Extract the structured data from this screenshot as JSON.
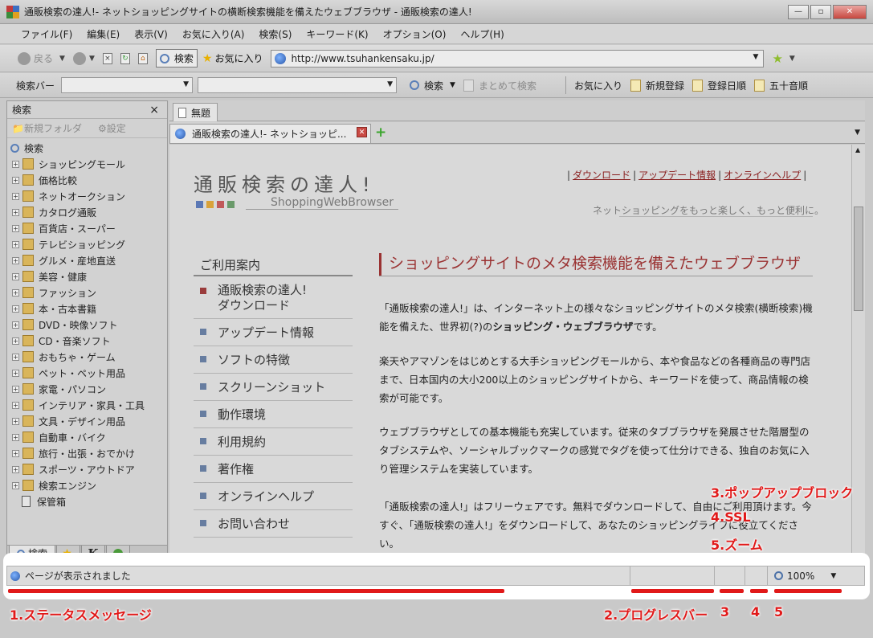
{
  "window": {
    "title": "通販検索の達人!- ネットショッピングサイトの横断検索機能を備えたウェブブラウザ - 通販検索の達人!",
    "icon_colors": [
      "#c23b3b",
      "#3b6fc2",
      "#3b8c3b",
      "#e0a020"
    ]
  },
  "menu": [
    "ファイル(F)",
    "編集(E)",
    "表示(V)",
    "お気に入り(A)",
    "検索(S)",
    "キーワード(K)",
    "オプション(O)",
    "ヘルプ(H)"
  ],
  "toolbar": {
    "back": "戻る",
    "search": "検索",
    "favorites": "お気に入り",
    "url": "http://www.tsuhankensaku.jp/"
  },
  "searchbar": {
    "label": "検索バー",
    "search_button": "検索",
    "batch_search": "まとめて検索",
    "favorites": "お気に入り",
    "new_register": "新規登録",
    "by_date": "登録日順",
    "by_kana": "五十音順"
  },
  "left_panel": {
    "title": "検索",
    "close": "×",
    "new_folder": "新規フォルダ",
    "settings": "設定",
    "root": "検索",
    "items": [
      "ショッピングモール",
      "価格比較",
      "ネットオークション",
      "カタログ通販",
      "百貨店・スーパー",
      "テレビショッピング",
      "グルメ・産地直送",
      "美容・健康",
      "ファッション",
      "本・古本書籍",
      "DVD・映像ソフト",
      "CD・音楽ソフト",
      "おもちゃ・ゲーム",
      "ペット・ペット用品",
      "家電・パソコン",
      "インテリア・家具・工具",
      "文具・デザイン用品",
      "自動車・バイク",
      "旅行・出張・おでかけ",
      "スポーツ・アウトドア",
      "検索エンジン"
    ],
    "storage": "保管箱",
    "tabs": {
      "search": "検索",
      "k": "K"
    }
  },
  "tabs": {
    "group": "無題",
    "page": "通販検索の達人!- ネットショッピ..."
  },
  "page": {
    "logo": "通販検索の達人!",
    "logo_sub": "ShoppingWebBrowser",
    "logo_colors": [
      "#5b78b5",
      "#d9a23a",
      "#c05a5a",
      "#6a9a6a"
    ],
    "links": [
      "ダウンロード",
      "アップデート情報",
      "オンラインヘルプ"
    ],
    "tagline": "ネットショッピングをもっと楽しく、もっと便利に。",
    "guide_title": "ご利用案内",
    "nav": [
      "通販検索の達人!\nダウンロード",
      "アップデート情報",
      "ソフトの特徴",
      "スクリーンショット",
      "動作環境",
      "利用規約",
      "著作権",
      "オンラインヘルプ",
      "お問い合わせ"
    ],
    "main_title": "ショッピングサイトのメタ検索機能を備えたウェブブラウザ",
    "p1a": "「通販検索の達人!」は、インターネット上の様々なショッピングサイトのメタ検索(横断検索)機能を備えた、世界初(?)の",
    "p1b": "ショッピング・ウェブブラウザ",
    "p1c": "です。",
    "p2": "楽天やアマゾンをはじめとする大手ショッピングモールから、本や食品などの各種商品の専門店まで、日本国内の大小200以上のショッピングサイトから、キーワードを使って、商品情報の検索が可能です。",
    "p3": "ウェブブラウザとしての基本機能も充実しています。従来のタブブラウザを発展させた階層型のタブシステムや、ソーシャルブックマークの感覚でタグを使って仕分けできる、独自のお気に入り管理システムを実装しています。",
    "p4": "「通販検索の達人!」はフリーウェアです。無料でダウンロードして、自由にご利用頂けます。今すぐ、「通販検索の達人!」をダウンロードして、あなたのショッピングライフに役立てください。"
  },
  "status": {
    "message": "ページが表示されました",
    "zoom": "100%"
  },
  "annotations": {
    "a1": "1.ステータスメッセージ",
    "a2": "2.プログレスバー",
    "a3": "3",
    "a4": "4",
    "a5": "5",
    "b3": "3.ポップアップブロック",
    "b4": "4.SSL",
    "b5": "5.ズーム"
  }
}
